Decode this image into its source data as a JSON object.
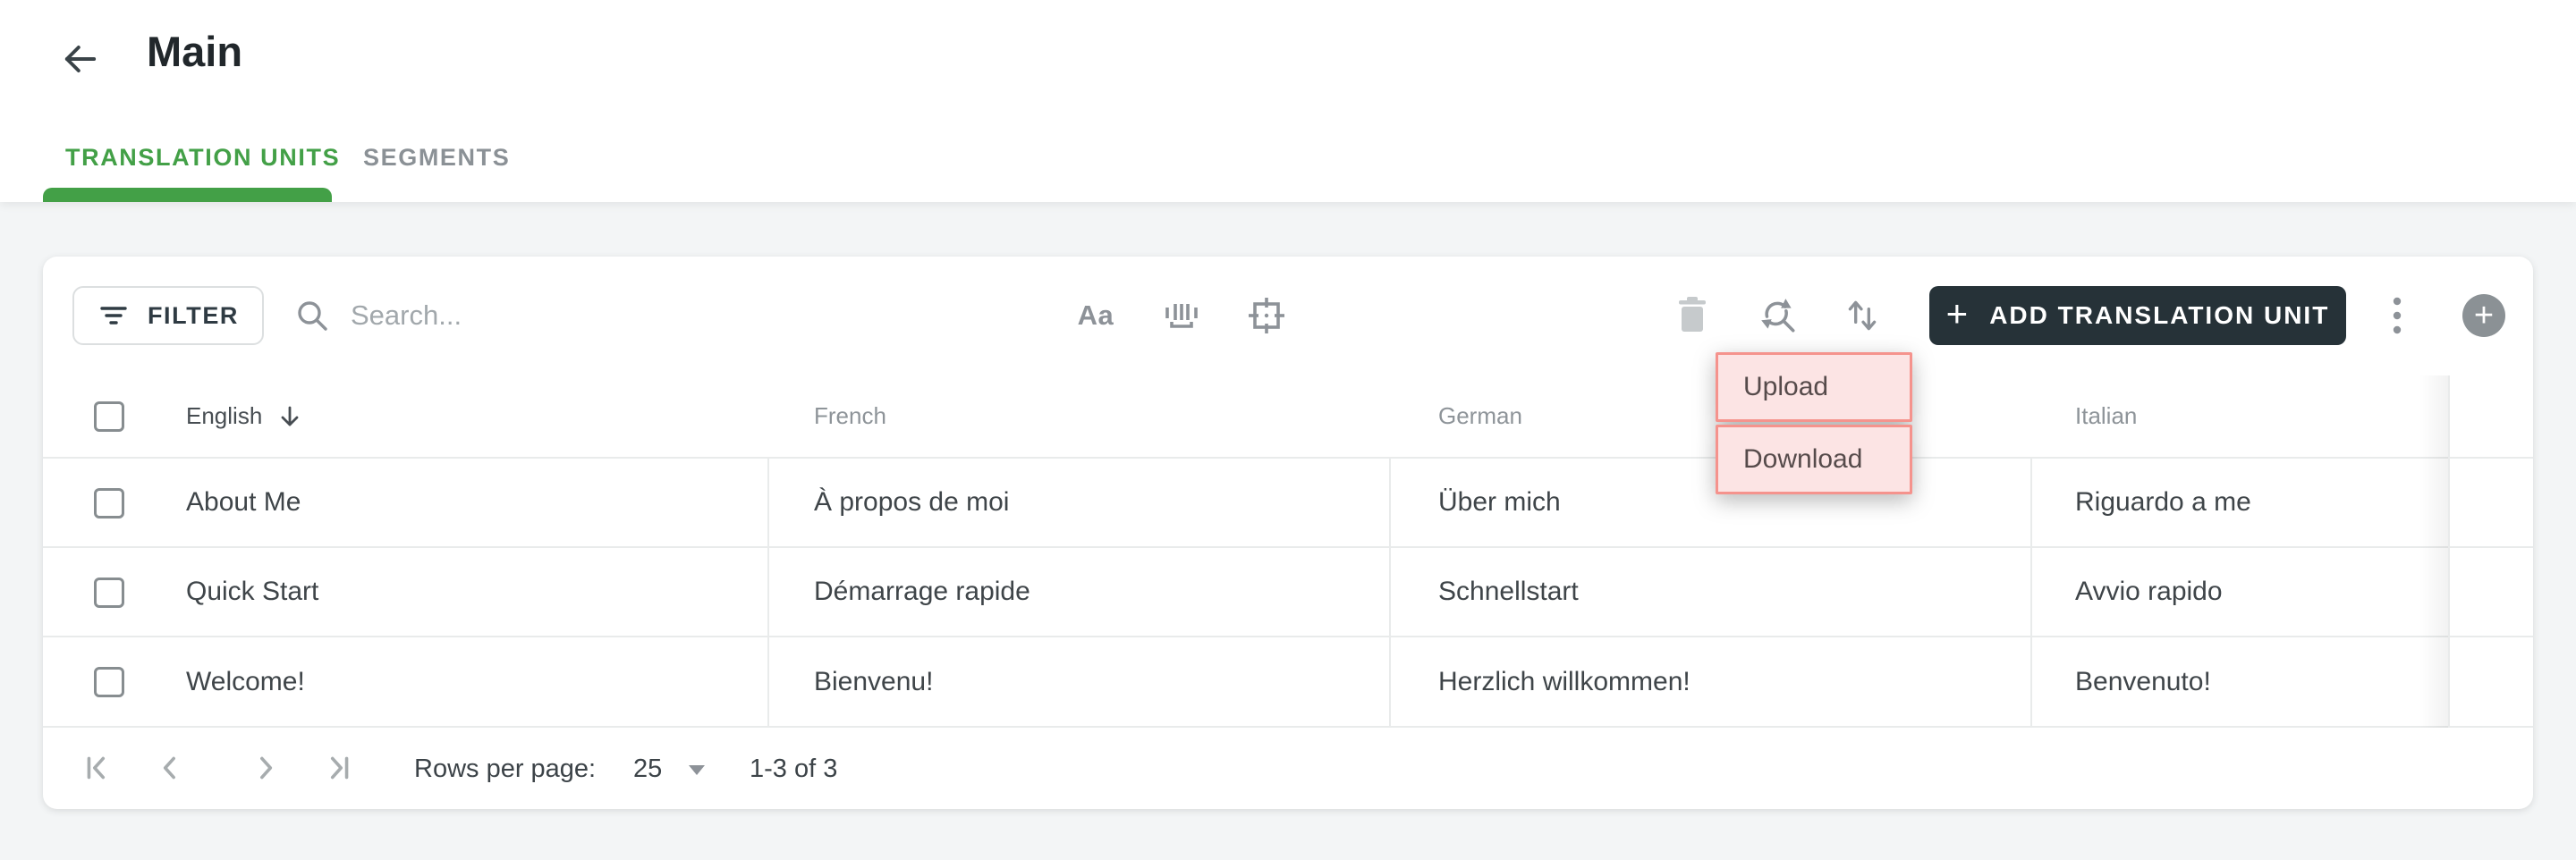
{
  "app": {
    "title": "Main",
    "tabs": [
      {
        "label": "TRANSLATION UNITS",
        "active": true
      },
      {
        "label": "SEGMENTS",
        "active": false
      }
    ]
  },
  "toolbar": {
    "filter_label": "FILTER",
    "search_placeholder": "Search...",
    "search_value": "",
    "aa_label": "Aa",
    "add_button_plus": "+",
    "add_button_label": "ADD TRANSLATION UNIT",
    "fab_plus": "+"
  },
  "menu": {
    "items": [
      {
        "label": "Upload"
      },
      {
        "label": "Download"
      }
    ]
  },
  "table": {
    "columns": [
      {
        "label": "English",
        "sorted": true,
        "sort_arrow": "down"
      },
      {
        "label": "French",
        "sorted": false
      },
      {
        "label": "German",
        "sorted": false
      },
      {
        "label": "Italian",
        "sorted": false
      }
    ],
    "rows": [
      {
        "english": "About Me",
        "french": "À propos de moi",
        "german": "Über mich",
        "italian": "Riguardo a me"
      },
      {
        "english": "Quick Start",
        "french": "Démarrage rapide",
        "german": "Schnellstart",
        "italian": "Avvio rapido"
      },
      {
        "english": "Welcome!",
        "french": "Bienvenu!",
        "german": "Herzlich willkommen!",
        "italian": "Benvenuto!"
      }
    ]
  },
  "pagination": {
    "rows_per_page_label": "Rows per page:",
    "rows_per_page_value": "25",
    "range_label": "1-3 of 3"
  },
  "colors": {
    "accent_green": "#43a047",
    "dark_button": "#263238",
    "menu_border": "#f5938d",
    "menu_bg": "#fce4e4",
    "page_bg": "#f3f5f6"
  }
}
